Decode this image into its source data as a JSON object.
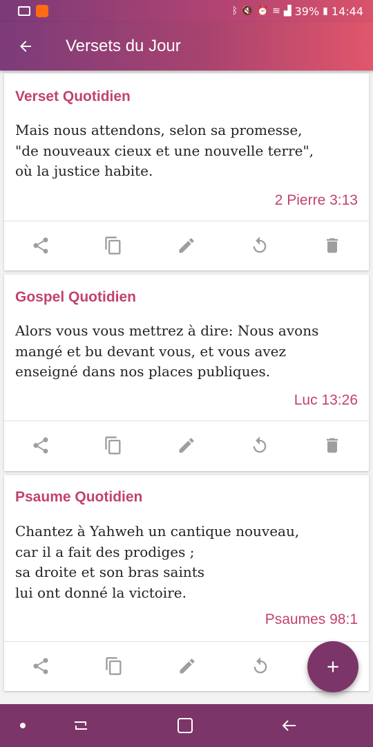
{
  "status": {
    "battery_percent": "39%",
    "time": "14:44",
    "icons": [
      "image-icon",
      "app-notification-icon",
      "bluetooth-icon",
      "mute-icon",
      "alarm-icon",
      "wifi-icon",
      "signal-icon",
      "battery-icon"
    ]
  },
  "app_bar": {
    "title": "Versets du Jour",
    "back_icon": "arrow-back-icon"
  },
  "cards": [
    {
      "heading": "Verset Quotidien",
      "text": "Mais nous attendons, selon sa promesse,\n\"de nouveaux cieux et une nouvelle terre\",\noù la justice habite.",
      "reference": "2 Pierre 3:13",
      "actions": [
        "share-icon",
        "copy-icon",
        "edit-icon",
        "refresh-icon",
        "delete-icon"
      ]
    },
    {
      "heading": "Gospel Quotidien",
      "text": "Alors vous vous mettrez à dire: Nous avons\nmangé et bu devant vous, et vous avez\nenseigné dans nos places publiques.",
      "reference": "Luc 13:26",
      "actions": [
        "share-icon",
        "copy-icon",
        "edit-icon",
        "refresh-icon",
        "delete-icon"
      ]
    },
    {
      "heading": "Psaume Quotidien",
      "text": "Chantez à Yahweh un cantique nouveau,\ncar il a fait des prodiges ;\nsa droite et son bras saints\nlui ont donné la victoire.",
      "reference": "Psaumes 98:1",
      "actions": [
        "share-icon",
        "copy-icon",
        "edit-icon",
        "refresh-icon"
      ]
    }
  ],
  "fab": {
    "icon": "plus-icon"
  },
  "nav": {
    "icons": [
      "dot-icon",
      "recent-apps-icon",
      "home-icon",
      "back-icon"
    ]
  },
  "colors": {
    "accent": "#c2436a",
    "primary": "#7c3568",
    "icon_grey": "#9e9e9e"
  }
}
